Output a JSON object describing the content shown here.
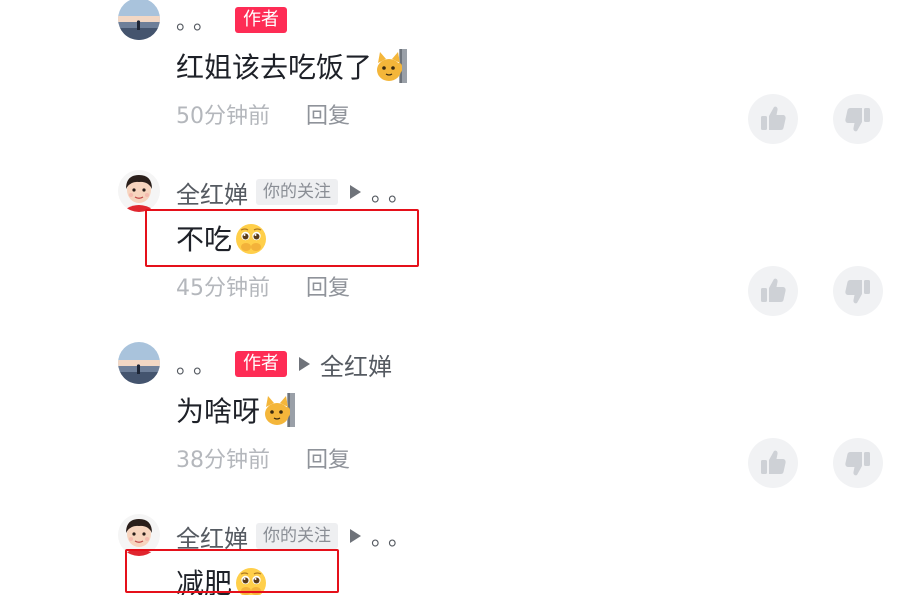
{
  "comments": [
    {
      "author": "。。",
      "tag": "作者",
      "text": "红姐该去吃饭了",
      "emoji_icon": "cat-peek-emoji",
      "time": "50分钟前",
      "reply_label": "回复"
    },
    {
      "author": "全红婵",
      "tag": "你的关注",
      "reply_to": "。。",
      "text": "不吃",
      "emoji_icon": "pleading-face-emoji",
      "time": "45分钟前",
      "reply_label": "回复"
    },
    {
      "author": "。。",
      "tag": "作者",
      "reply_to": "全红婵",
      "text": "为啥呀",
      "emoji_icon": "cat-peek-emoji",
      "time": "38分钟前",
      "reply_label": "回复"
    },
    {
      "author": "全红婵",
      "tag": "你的关注",
      "reply_to": "。。",
      "text": "减肥",
      "emoji_icon": "pleading-face-emoji"
    }
  ],
  "icons": {
    "like": "thumbs-up-icon",
    "dislike": "thumbs-down-icon",
    "reply_arrow": "play-arrow-icon"
  },
  "colors": {
    "author_tag": "#fe2c55",
    "highlight_box": "#e5101a",
    "vote_bg": "#f1f2f4"
  }
}
